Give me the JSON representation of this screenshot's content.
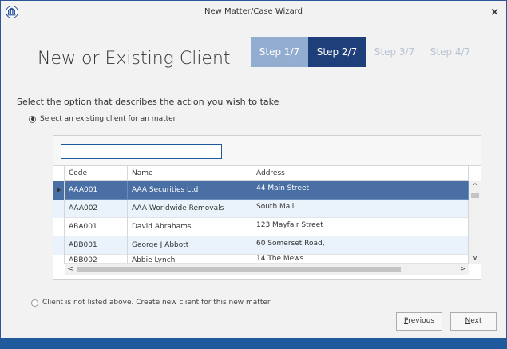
{
  "window": {
    "title": "New Matter/Case Wizard",
    "close_label": "×"
  },
  "header": {
    "heading": "New or Existing Client",
    "steps": [
      {
        "label": "Step 1/7",
        "state": "done"
      },
      {
        "label": "Step 2/7",
        "state": "current"
      },
      {
        "label": "Step 3/7",
        "state": "future"
      },
      {
        "label": "Step 4/7",
        "state": "future"
      }
    ]
  },
  "prompt": "Select the option that describes the action you wish to take",
  "options": {
    "existing_client": {
      "label": "Select an existing client for an matter",
      "checked": true
    },
    "new_client": {
      "label": "Client is not listed above. Create new client for this new matter",
      "checked": false
    }
  },
  "search": {
    "value": "",
    "placeholder": ""
  },
  "grid": {
    "columns": [
      "Code",
      "Name",
      "Address"
    ],
    "rows": [
      {
        "code": "AAA001",
        "name": "AAA Securities Ltd",
        "address": "44 Main Street",
        "selected": true
      },
      {
        "code": "AAA002",
        "name": "AAA Worldwide Removals",
        "address": "South Mall",
        "selected": false
      },
      {
        "code": "ABA001",
        "name": "David Abrahams",
        "address": "123 Mayfair Street",
        "selected": false
      },
      {
        "code": "ABB001",
        "name": "George J Abbott",
        "address": "60 Somerset Road,",
        "selected": false
      },
      {
        "code": "ABB002",
        "name": "Abbie Lynch",
        "address": "14  The Mews",
        "selected": false
      }
    ]
  },
  "buttons": {
    "previous": {
      "accel": "P",
      "rest": "revious"
    },
    "next": {
      "accel": "N",
      "rest": "ext"
    }
  },
  "colors": {
    "accent": "#1f5b9c",
    "step_current": "#1f3f7a",
    "step_done": "#93add0",
    "selected_row": "#4a6fa5"
  }
}
